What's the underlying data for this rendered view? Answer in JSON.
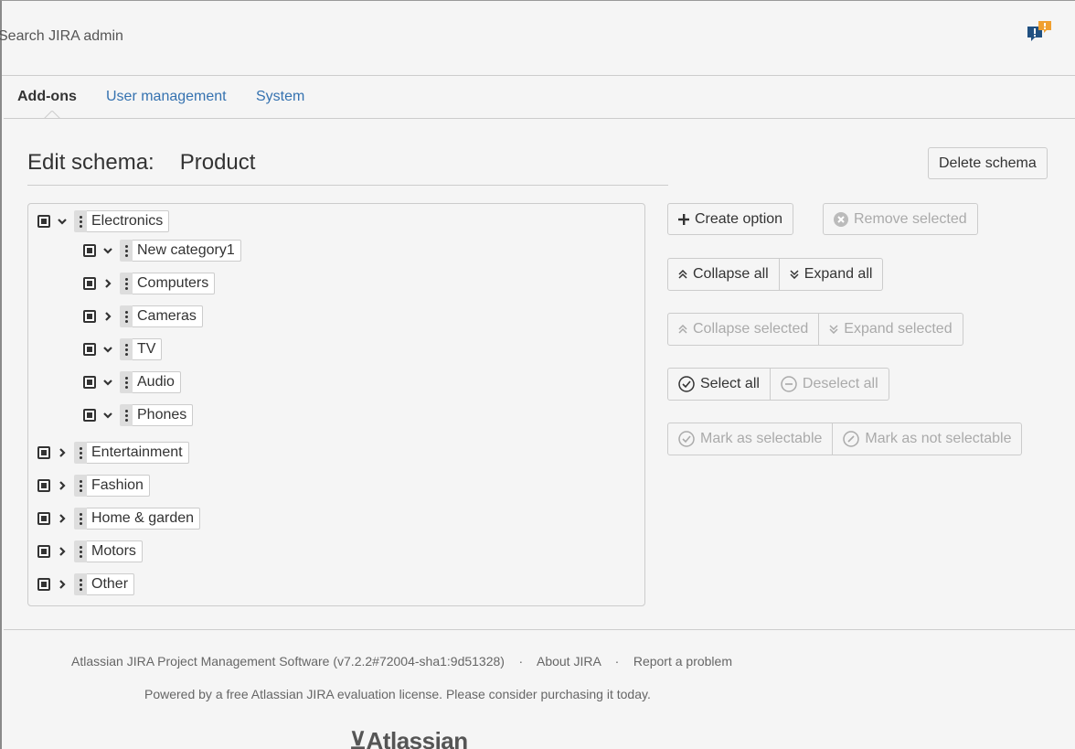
{
  "header": {
    "search_placeholder": "Search JIRA admin",
    "feedback_icon": "feedback-icon"
  },
  "nav": {
    "tabs": [
      {
        "label": "Add-ons",
        "active": true
      },
      {
        "label": "User management",
        "active": false
      },
      {
        "label": "System",
        "active": false
      }
    ]
  },
  "page": {
    "title_prefix": "Edit schema:",
    "schema_name": "Product",
    "delete_button": "Delete schema"
  },
  "actions": {
    "create_option": "Create option",
    "remove_selected": "Remove selected",
    "collapse_all": "Collapse all",
    "expand_all": "Expand all",
    "collapse_selected": "Collapse selected",
    "expand_selected": "Expand selected",
    "select_all": "Select all",
    "deselect_all": "Deselect all",
    "mark_selectable": "Mark as selectable",
    "mark_not_selectable": "Mark as not selectable"
  },
  "tree": {
    "items": [
      {
        "label": "Electronics",
        "expanded": true,
        "level": 0
      },
      {
        "label": "New category1",
        "expanded": true,
        "level": 1
      },
      {
        "label": "Computers",
        "expanded": false,
        "level": 1
      },
      {
        "label": "Cameras",
        "expanded": false,
        "level": 1
      },
      {
        "label": "TV",
        "expanded": true,
        "level": 1
      },
      {
        "label": "Audio",
        "expanded": true,
        "level": 1
      },
      {
        "label": "Phones",
        "expanded": true,
        "level": 1
      },
      {
        "label": "Entertainment",
        "expanded": false,
        "level": 0
      },
      {
        "label": "Fashion",
        "expanded": false,
        "level": 0
      },
      {
        "label": "Home & garden",
        "expanded": false,
        "level": 0
      },
      {
        "label": "Motors",
        "expanded": false,
        "level": 0
      },
      {
        "label": "Other",
        "expanded": false,
        "level": 0
      }
    ]
  },
  "footer": {
    "software": "Atlassian JIRA Project Management Software (v7.2.2#72004-sha1:9d51328)",
    "sep1": "·",
    "about": "About JIRA",
    "sep2": "·",
    "report": "Report a problem",
    "license": "Powered by a free Atlassian JIRA evaluation license. Please consider purchasing it today.",
    "logo": "Atlassian"
  },
  "colors": {
    "link": "#3572b0",
    "background": "#f5f5f5",
    "feedback_blue": "#205081",
    "feedback_orange": "#f0a030"
  }
}
